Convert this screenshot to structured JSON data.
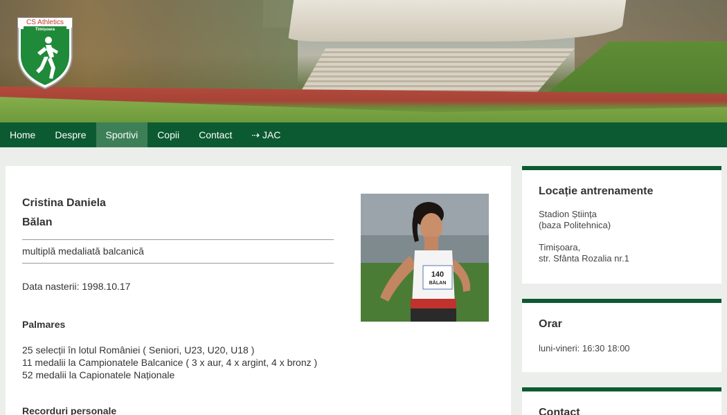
{
  "logo": {
    "title": "CS Athletics",
    "city": "Timișoara",
    "icon": "runner-shield-icon"
  },
  "nav": {
    "items": [
      {
        "label": "Home"
      },
      {
        "label": "Despre"
      },
      {
        "label": "Sportivi"
      },
      {
        "label": "Copii"
      },
      {
        "label": "Contact"
      },
      {
        "label": "⇢ JAC"
      }
    ],
    "active": "Sportivi"
  },
  "athlete": {
    "first_name": "Cristina Daniela",
    "last_name": "Bălan",
    "subtitle": "multiplă medaliată balcanică",
    "birth": "Data nasterii: 1998.10.17",
    "palmares_title": "Palmares",
    "palmares": [
      "25 selecții în lotul României ( Seniori, U23, U20, U18 )",
      "11 medalii la Campionatele Balcanice ( 3 x aur, 4 x argint, 4 x bronz )",
      "52 medalii la Capionatele Naționale"
    ],
    "records_title": "Recorduri personale",
    "bib_number": "140",
    "bib_name": "BĂLAN"
  },
  "sidebar": {
    "location": {
      "title": "Locație antrenamente",
      "line1": "Stadion Știința",
      "line2": "(baza Politehnica)",
      "line3": "Timișoara,",
      "line4": "str. Sfânta Rozalia nr.1"
    },
    "schedule": {
      "title": "Orar",
      "hours": "luni-vineri: 16:30 18:00"
    },
    "contact": {
      "title": "Contact"
    }
  },
  "colors": {
    "nav_bg": "#0c5a32",
    "nav_active": "#3d7f57",
    "accent": "#0c5a32"
  }
}
